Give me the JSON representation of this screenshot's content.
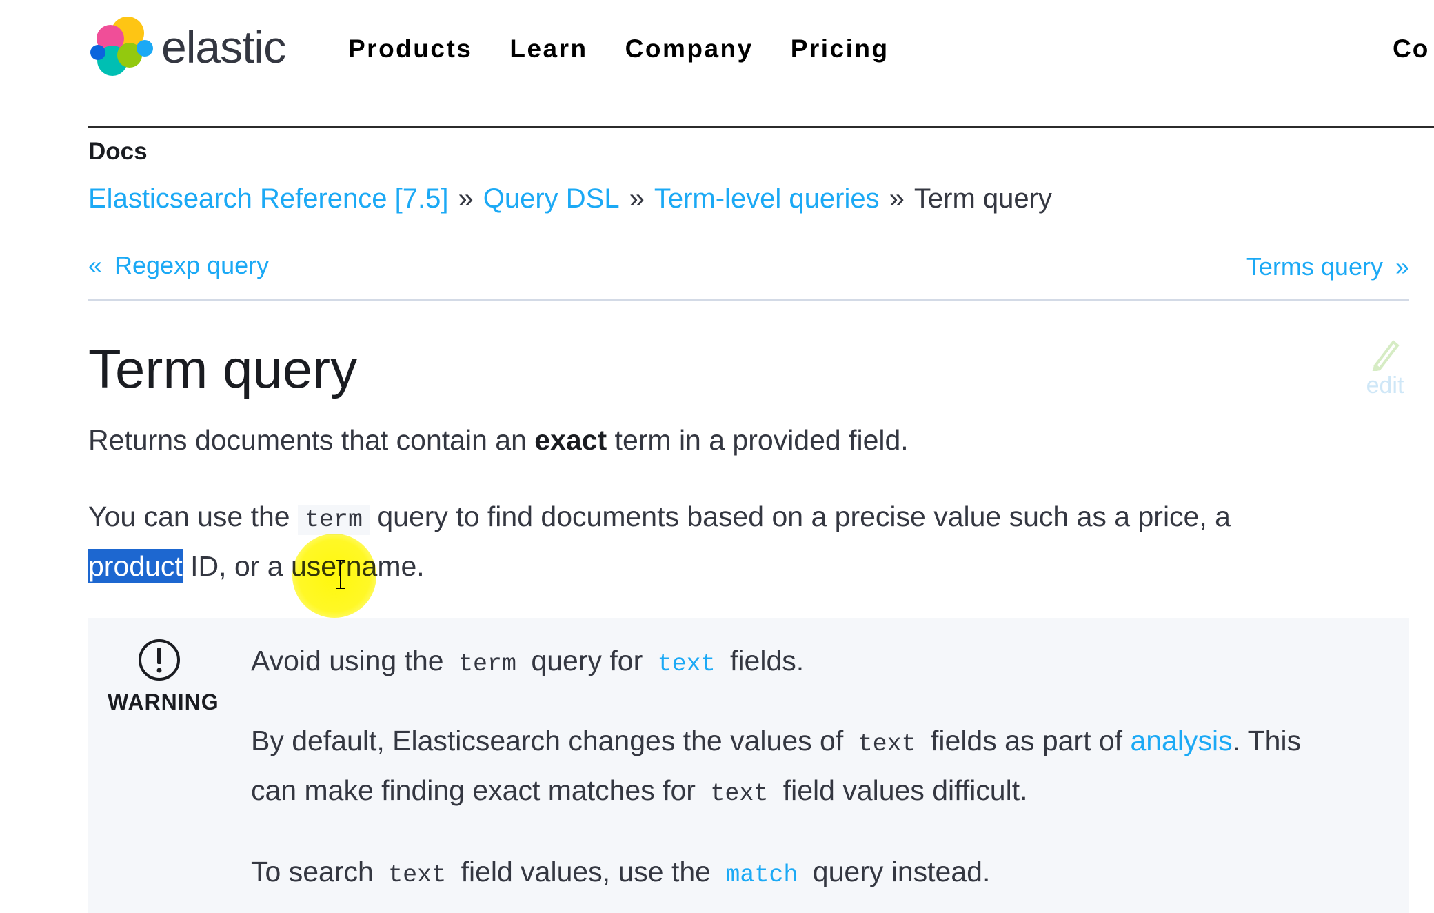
{
  "nav": {
    "brand": "elastic",
    "links": [
      "Products",
      "Learn",
      "Company",
      "Pricing"
    ],
    "cut_link": "Co",
    "logo_colors": [
      "#fec514",
      "#f04e98",
      "#00bfb3",
      "#1ba9f5",
      "#93c90e"
    ]
  },
  "docs": {
    "label": "Docs",
    "breadcrumb": [
      {
        "label": "Elasticsearch Reference [7.5]",
        "link": true
      },
      {
        "label": "Query DSL",
        "link": true
      },
      {
        "label": "Term-level queries",
        "link": true
      },
      {
        "label": "Term query",
        "link": false
      }
    ],
    "separator": "»",
    "prev": {
      "arrow": "«",
      "label": "Regexp query"
    },
    "next": {
      "arrow": "»",
      "label": "Terms query"
    }
  },
  "page": {
    "title": "Term query",
    "edit_label": "edit",
    "intro": {
      "before": "Returns documents that contain an ",
      "bold": "exact",
      "after": " term in a provided field."
    },
    "usage": {
      "before": "You can use the ",
      "code": "term",
      "after": " query to find documents based on a precise value such as a price, a",
      "line2_selected": "product",
      "line2_rest": " ID, or a username."
    }
  },
  "warning": {
    "label": "WARNING",
    "line1": {
      "before": "Avoid using the ",
      "code1": "term",
      "middle": " query for ",
      "code2": "text",
      "after": " fields."
    },
    "line2": {
      "before": "By default, Elasticsearch changes the values of ",
      "code": "text",
      "middle": " fields as part of ",
      "link": "analysis",
      "after": ". This"
    },
    "line2b": {
      "before": "can make finding exact matches for ",
      "code": "text",
      "after": " field values difficult."
    },
    "line3": {
      "before": "To search ",
      "code1": "text",
      "middle": " field values, use the ",
      "code2": "match",
      "after": " query instead."
    }
  },
  "colors": {
    "link": "#1ba9f5",
    "selection": "#1d67d0",
    "cursor_highlight": "#fff700"
  }
}
